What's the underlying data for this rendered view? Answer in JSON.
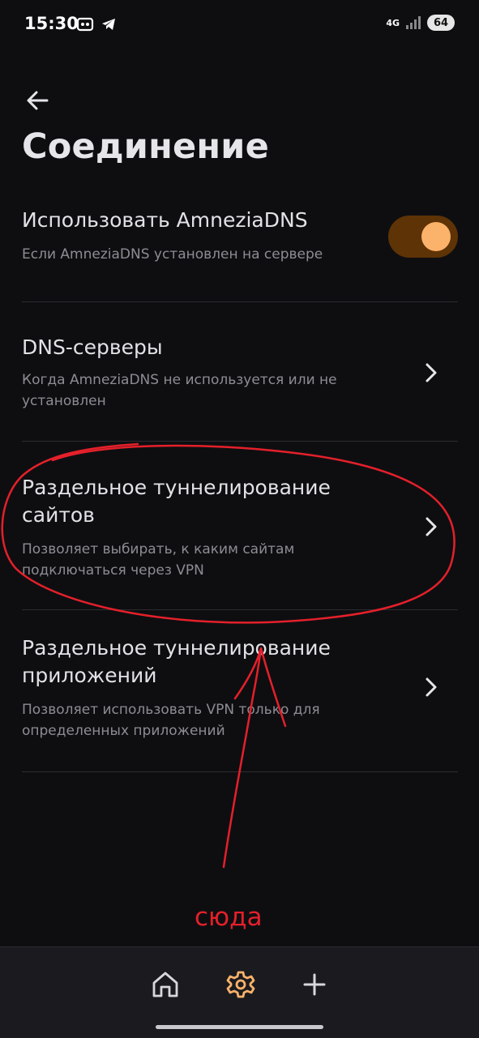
{
  "status_bar": {
    "time": "15:30",
    "network": "4G",
    "battery": "64"
  },
  "page": {
    "title": "Соединение"
  },
  "settings": [
    {
      "title": "Использовать AmneziaDNS",
      "subtitle": "Если AmneziaDNS установлен на сервере",
      "control": "toggle",
      "enabled": true
    },
    {
      "title": "DNS-серверы",
      "subtitle": "Когда AmneziaDNS не используется или не установлен",
      "control": "chevron-right-icon"
    },
    {
      "title": "Раздельное туннелирование сайтов",
      "subtitle": "Позволяет выбирать, к каким сайтам подключаться через VPN",
      "control": "chevron-right-icon"
    },
    {
      "title": "Раздельное туннелирование приложений",
      "subtitle": "Позволяет использовать VPN только для определенных приложений",
      "control": "chevron-right-icon"
    }
  ],
  "annotation": {
    "label": "сюда",
    "color": "#e4202a"
  },
  "bottom_nav": [
    {
      "icon": "home-icon",
      "active": false
    },
    {
      "icon": "gear-icon",
      "active": true
    },
    {
      "icon": "plus-icon",
      "active": false
    }
  ],
  "colors": {
    "background": "#0e0e11",
    "accent": "#fbb26a",
    "toggle_track": "#5e3306"
  }
}
